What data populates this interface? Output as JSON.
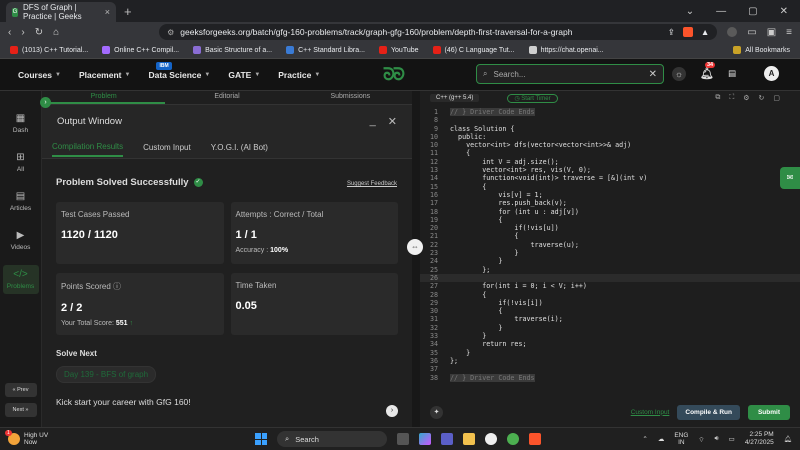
{
  "browser": {
    "tab_title": "DFS of Graph | Practice | Geeks",
    "tab_close": "×",
    "new_tab": "+",
    "url": "geeksforgeeks.org/batch/gfg-160-problems/track/graph-gfg-160/problem/depth-first-traversal-for-a-graph",
    "bookmarks": [
      {
        "label": "(1013) C++ Tutorial...",
        "color": "#e62117"
      },
      {
        "label": "Online C++ Compil...",
        "color": "#a36bff"
      },
      {
        "label": "Basic Structure of a...",
        "color": "#8a6dd4"
      },
      {
        "label": "C++ Standard Libra...",
        "color": "#3a7bd5"
      },
      {
        "label": "YouTube",
        "color": "#e62117"
      },
      {
        "label": "(46) C Language Tut...",
        "color": "#e62117"
      },
      {
        "label": "https://chat.openai...",
        "color": "#cfcfcf"
      }
    ],
    "all_bookmarks": "All Bookmarks"
  },
  "gfg_nav": {
    "items": [
      "Courses",
      "Placement",
      "Data Science",
      "GATE",
      "Practice"
    ],
    "ibm_badge": "IBM",
    "search_placeholder": "Search...",
    "notif_count": "34",
    "avatar_letter": "A"
  },
  "left_nav": {
    "items": [
      "Dash",
      "All",
      "Articles",
      "Videos",
      "Problems"
    ],
    "prev": "Prev",
    "next": "Next"
  },
  "problem_tabs": [
    "Problem",
    "Editorial",
    "Submissions"
  ],
  "output": {
    "title": "Output Window",
    "tabs": [
      "Compilation Results",
      "Custom Input",
      "Y.O.G.I. (AI Bot)"
    ],
    "status": "Problem Solved Successfully",
    "feedback": "Suggest Feedback",
    "test_cases_label": "Test Cases Passed",
    "test_cases_value": "1120 / 1120",
    "attempts_label": "Attempts : Correct / Total",
    "attempts_value": "1 / 1",
    "accuracy_label": "Accuracy :",
    "accuracy_value": "100%",
    "points_label": "Points Scored",
    "points_value": "2 / 2",
    "total_score_label": "Your Total Score:",
    "total_score_value": "551",
    "time_label": "Time Taken",
    "time_value": "0.05",
    "solve_next": "Solve Next",
    "next_problem": "Day 139 - BFS of graph",
    "kick": "Kick start your career with GfG 160!"
  },
  "editor": {
    "language": "C++ (g++ 5.4)",
    "timer": "Start Timer",
    "custom_input": "Custom Input",
    "compile_run": "Compile & Run",
    "submit": "Submit",
    "lines": [
      {
        "n": "1",
        "t": "// } Driver Code Ends",
        "c": true
      },
      {
        "n": "8",
        "t": ""
      },
      {
        "n": "9",
        "t": "class Solution {"
      },
      {
        "n": "10",
        "t": "  public:"
      },
      {
        "n": "10",
        "t": "    vector<int> dfs(vector<vector<int>>& adj)"
      },
      {
        "n": "11",
        "t": "    {"
      },
      {
        "n": "12",
        "t": "        int V = adj.size();"
      },
      {
        "n": "13",
        "t": "        vector<int> res, vis(V, 0);"
      },
      {
        "n": "14",
        "t": "        function<void(int)> traverse = [&](int v)"
      },
      {
        "n": "15",
        "t": "        {"
      },
      {
        "n": "16",
        "t": "            vis[v] = 1;"
      },
      {
        "n": "17",
        "t": "            res.push_back(v);"
      },
      {
        "n": "18",
        "t": "            for (int u : adj[v])"
      },
      {
        "n": "19",
        "t": "            {"
      },
      {
        "n": "20",
        "t": "                if(!vis[u])"
      },
      {
        "n": "21",
        "t": "                {"
      },
      {
        "n": "22",
        "t": "                    traverse(u);"
      },
      {
        "n": "23",
        "t": "                }"
      },
      {
        "n": "24",
        "t": "            }"
      },
      {
        "n": "25",
        "t": "        };"
      },
      {
        "n": "26",
        "t": "",
        "hl": true
      },
      {
        "n": "27",
        "t": "        for(int i = 0; i < V; i++)"
      },
      {
        "n": "28",
        "t": "        {"
      },
      {
        "n": "29",
        "t": "            if(!vis[i])"
      },
      {
        "n": "30",
        "t": "            {"
      },
      {
        "n": "31",
        "t": "                traverse(i);"
      },
      {
        "n": "32",
        "t": "            }"
      },
      {
        "n": "33",
        "t": "        }"
      },
      {
        "n": "34",
        "t": "        return res;"
      },
      {
        "n": "35",
        "t": "    }"
      },
      {
        "n": "36",
        "t": "};"
      },
      {
        "n": "37",
        "t": ""
      },
      {
        "n": "38",
        "t": "// } Driver Code Ends",
        "c": true
      }
    ]
  },
  "taskbar": {
    "weather_title": "High UV",
    "weather_sub": "Now",
    "weather_badge": "1",
    "search": "Search",
    "lang": "ENG",
    "region": "IN",
    "time": "2:25 PM",
    "date": "4/27/2025"
  },
  "colors": {
    "accent": "#2f8d46",
    "background": "#1e1e1e"
  }
}
